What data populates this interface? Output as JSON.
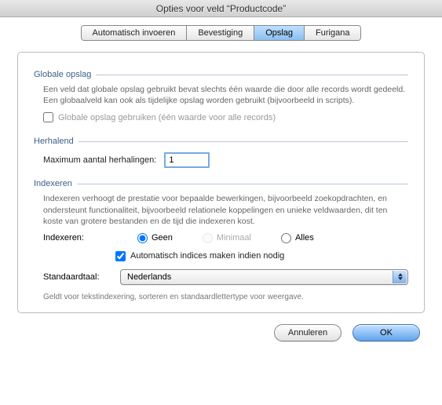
{
  "window": {
    "title": "Opties voor veld “Productcode”"
  },
  "tabs": {
    "auto": "Automatisch invoeren",
    "bevest": "Bevestiging",
    "opslag": "Opslag",
    "furigana": "Furigana",
    "active": "opslag"
  },
  "globale": {
    "header": "Globale opslag",
    "desc": "Een veld dat globale opslag gebruikt bevat slechts één waarde die door alle records wordt gedeeld.  Een globaalveld kan ook als tijdelijke opslag worden gebruikt (bijvoorbeeld in scripts).",
    "checkbox_label": "Globale opslag gebruiken (één waarde voor alle records)",
    "checkbox_checked": false
  },
  "herhalend": {
    "header": "Herhalend",
    "max_label": "Maximum aantal herhalingen:",
    "max_value": "1"
  },
  "indexeren": {
    "header": "Indexeren",
    "desc": "Indexeren verhoogt de prestatie voor bepaalde bewerkingen, bijvoorbeeld zoekopdrachten, en ondersteunt functionaliteit, bijvoorbeeld relationele koppelingen en unieke veldwaarden, dit ten koste van grotere bestanden en de tijd die indexeren kost.",
    "row_label": "Indexeren:",
    "opt_geen": "Geen",
    "opt_minimaal": "Minimaal",
    "opt_alles": "Alles",
    "selected": "geen",
    "minimaal_enabled": false,
    "auto_index_label": "Automatisch indices maken indien nodig",
    "auto_index_checked": true,
    "lang_label": "Standaardtaal:",
    "lang_value": "Nederlands",
    "footnote": "Geldt voor tekstindexering, sorteren en standaardlettertype voor weergave."
  },
  "buttons": {
    "cancel": "Annuleren",
    "ok": "OK"
  }
}
